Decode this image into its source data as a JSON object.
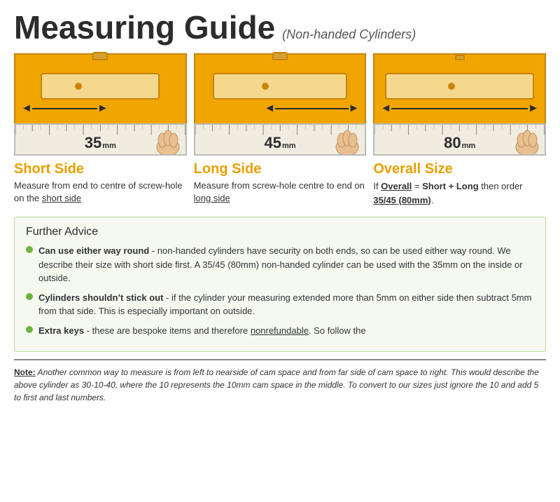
{
  "header": {
    "title": "Measuring Guide",
    "subtitle": "(Non-handed Cylinders)"
  },
  "diagrams": [
    {
      "id": "short",
      "label": "Short Side",
      "description": "Measure from end to centre of screw-hole on the ",
      "description_link": "short side",
      "size_number": "35",
      "size_unit": "mm",
      "arrow_position": "left"
    },
    {
      "id": "long",
      "label": "Long Side",
      "description": "Measure from screw-hole centre to end on ",
      "description_link": "long side",
      "size_number": "45",
      "size_unit": "mm",
      "arrow_position": "right"
    },
    {
      "id": "overall",
      "label": "Overall Size",
      "description_line1": "If ",
      "description_bold1": "Overall",
      "description_eq": " = ",
      "description_bold2": "Short + Long",
      "description_line2": " then order ",
      "description_link": "35/45 (80mm)",
      "description_end": ".",
      "size_number": "80",
      "size_unit": "mm",
      "arrow_position": "full"
    }
  ],
  "advice": {
    "title": "Further Advice",
    "items": [
      {
        "bold": "Can use either way round",
        "text": " - non-handed cylinders have security on both ends, so can be used either way round. We describe their size with short side first. A 35/45 (80mm) non-handed cylinder can be used with the 35mm on the inside or outside."
      },
      {
        "bold": "Cylinders shouldn’t stick out",
        "text": " - if the cylinder your measuring extended more than 5mm on either side then subtract 5mm from that side. This is especially important on outside."
      },
      {
        "bold": "Extra keys",
        "text": " - these are bespoke items and therefore ",
        "underline": "nonrefundable",
        "text2": ". So follow the"
      }
    ]
  },
  "note": {
    "label": "Note:",
    "text": "  Another common way to measure is from left to nearside of cam space and from far side of cam space to right. This would describe the above cylinder as 30-10-40, where the 10 represents the 10mm cam space in the middle. To convert to our sizes just ignore the 10 and add 5 to first and last numbers."
  }
}
